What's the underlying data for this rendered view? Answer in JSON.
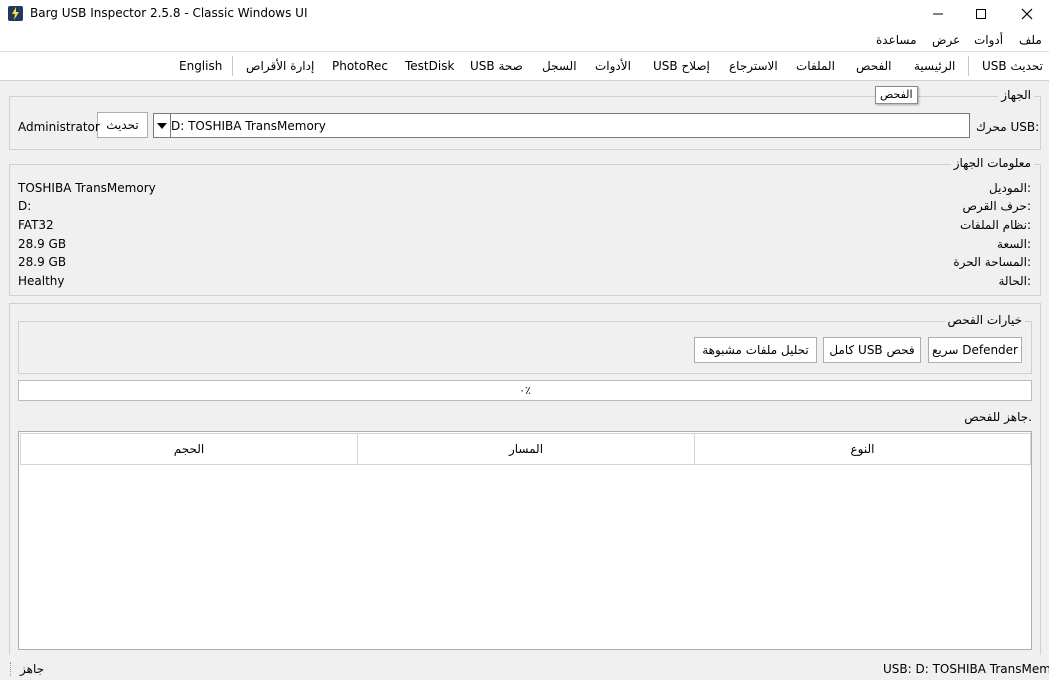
{
  "window": {
    "title": "Barg USB Inspector 2.5.8 - Classic Windows UI",
    "icon": "lightning-bolt-icon"
  },
  "menu": {
    "items": [
      "ملف",
      "أدوات",
      "عرض",
      "مساعدة"
    ]
  },
  "tabs": [
    "USB تحديث",
    "الرئيسية",
    "الفحص",
    "الملفات",
    "الاسترجاع",
    "USB إصلاح",
    "الأدوات",
    "السجل",
    "USB صحة",
    "TestDisk",
    "PhotoRec",
    "إدارة الأقراص",
    "English"
  ],
  "tooltip": "الفحص",
  "device": {
    "group_title": "الجهاز",
    "drive_label": "محرك USB:",
    "drive_value": "D:  TOSHIBA TransMemory",
    "refresh_label": "تحديث",
    "admin_label": "Administrator"
  },
  "info": {
    "group_title": "معلومات الجهاز",
    "rows": [
      {
        "label": "الموديل:",
        "value": "TOSHIBA TransMemory"
      },
      {
        "label": "حرف القرص:",
        "value": "D:"
      },
      {
        "label": "نظام الملفات:",
        "value": "FAT32"
      },
      {
        "label": "السعة:",
        "value": "28.9 GB"
      },
      {
        "label": "المساحة الحرة:",
        "value": "28.9 GB"
      },
      {
        "label": "الحالة:",
        "value": "Healthy"
      }
    ]
  },
  "scan": {
    "group_title": "خيارات الفحص",
    "quick_label": "سريع Defender",
    "full_label": "كامل USB فحص",
    "analyze_label": "تحليل ملفات مشبوهة",
    "progress_text": "٠٪",
    "progress_percent": 0,
    "status": "جاهز للفحص."
  },
  "table": {
    "columns": [
      "النوع",
      "المسار",
      "الحجم"
    ]
  },
  "statusbar": {
    "left": "جاهز",
    "right": "USB: D: TOSHIBA TransMemory"
  }
}
